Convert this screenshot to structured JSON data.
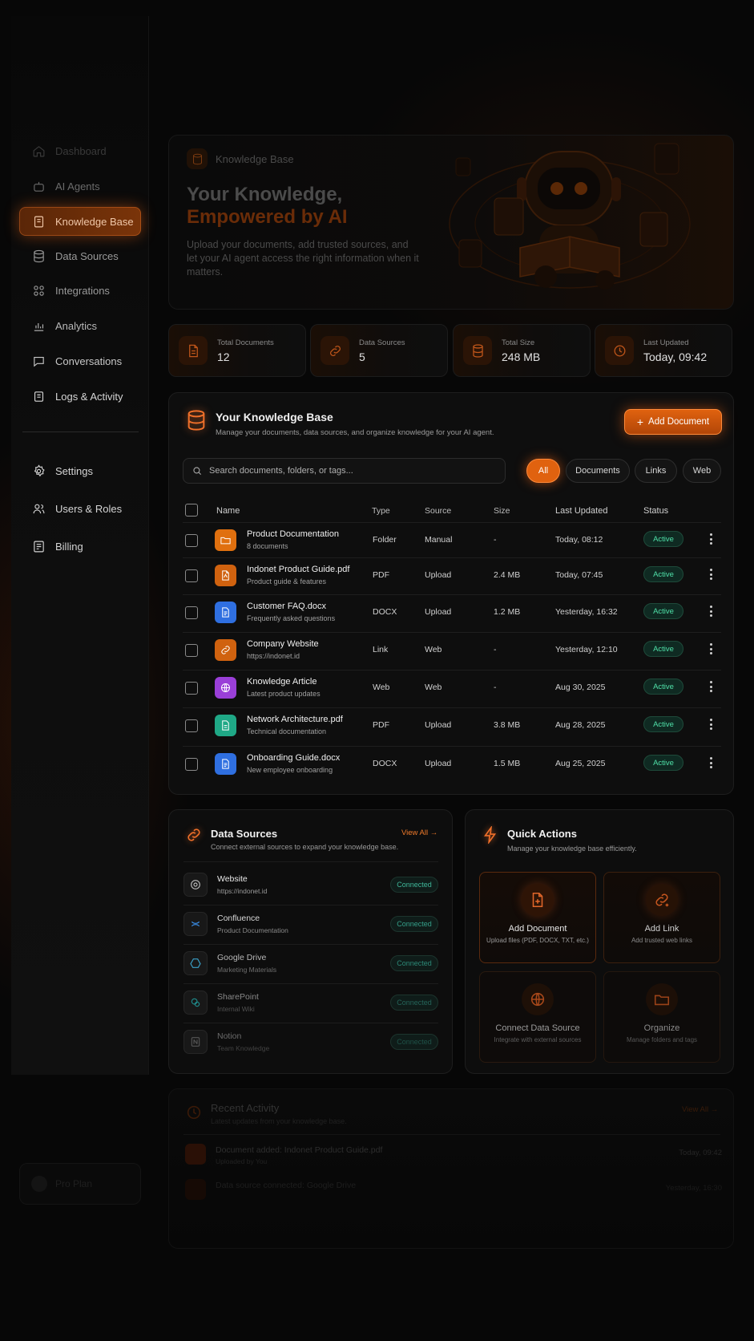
{
  "sidebar": {
    "items": [
      {
        "label": "Dashboard"
      },
      {
        "label": "AI Agents"
      },
      {
        "label": "Knowledge Base"
      },
      {
        "label": "Data Sources"
      },
      {
        "label": "Integrations"
      },
      {
        "label": "Analytics"
      },
      {
        "label": "Conversations"
      },
      {
        "label": "Logs & Activity"
      },
      {
        "label": "Settings"
      },
      {
        "label": "Users & Roles"
      },
      {
        "label": "Billing"
      }
    ],
    "plan": {
      "label": "Pro Plan"
    }
  },
  "hero": {
    "tag": "Knowledge Base",
    "title_line1": "Your Knowledge,",
    "title_line2": "Empowered by AI",
    "description": "Upload your documents, add trusted sources, and let your AI agent access the right information when it matters."
  },
  "stats": [
    {
      "label": "Total Documents",
      "value": "12",
      "icon": "document-icon"
    },
    {
      "label": "Data Sources",
      "value": "5",
      "icon": "link-icon"
    },
    {
      "label": "Total Size",
      "value": "248 MB",
      "icon": "database-icon"
    },
    {
      "label": "Last Updated",
      "value": "Today, 09:42",
      "icon": "clock-icon"
    }
  ],
  "kb": {
    "title": "Your Knowledge Base",
    "subtitle": "Manage your documents, data sources, and organize knowledge for your AI agent.",
    "add_button": "Add Document",
    "search_placeholder": "Search documents, folders, or tags...",
    "filters": [
      "All",
      "Documents",
      "Links",
      "Web"
    ],
    "columns": {
      "name": "Name",
      "type": "Type",
      "source": "Source",
      "size": "Size",
      "updated": "Last Updated",
      "status": "Status"
    },
    "rows": [
      {
        "name": "Product Documentation",
        "desc": "8 documents",
        "type": "Folder",
        "source": "Manual",
        "size": "-",
        "updated": "Today, 08:12",
        "status": "Active",
        "icon": "folder-icon",
        "color": "#e0700f"
      },
      {
        "name": "Indonet Product Guide.pdf",
        "desc": "Product guide & features",
        "type": "PDF",
        "source": "Upload",
        "size": "2.4 MB",
        "updated": "Today, 07:45",
        "status": "Active",
        "icon": "pdf-icon",
        "color": "#d0620f"
      },
      {
        "name": "Customer FAQ.docx",
        "desc": "Frequently asked questions",
        "type": "DOCX",
        "source": "Upload",
        "size": "1.2 MB",
        "updated": "Yesterday, 16:32",
        "status": "Active",
        "icon": "docx-icon",
        "color": "#2f6fe0"
      },
      {
        "name": "Company Website",
        "desc": "https://indonet.id",
        "type": "Link",
        "source": "Web",
        "size": "-",
        "updated": "Yesterday, 12:10",
        "status": "Active",
        "icon": "link-icon",
        "color": "#d0620f"
      },
      {
        "name": "Knowledge Article",
        "desc": "Latest product updates",
        "type": "Web",
        "source": "Web",
        "size": "-",
        "updated": "Aug 30, 2025",
        "status": "Active",
        "icon": "globe-icon",
        "color": "#9a3fd8"
      },
      {
        "name": "Network Architecture.pdf",
        "desc": "Technical documentation",
        "type": "PDF",
        "source": "Upload",
        "size": "3.8 MB",
        "updated": "Aug 28, 2025",
        "status": "Active",
        "icon": "sheet-icon",
        "color": "#1fa886"
      },
      {
        "name": "Onboarding Guide.docx",
        "desc": "New employee onboarding",
        "type": "DOCX",
        "source": "Upload",
        "size": "1.5 MB",
        "updated": "Aug 25, 2025",
        "status": "Active",
        "icon": "docx-icon",
        "color": "#2f6fe0"
      }
    ]
  },
  "data_sources": {
    "title": "Data Sources",
    "subtitle": "Connect external sources to expand your knowledge base.",
    "view_all": "View All",
    "items": [
      {
        "name": "Website",
        "sub": "https://indonet.id",
        "status": "Connected",
        "icon": "at-icon"
      },
      {
        "name": "Confluence",
        "sub": "Product Documentation",
        "status": "Connected",
        "icon": "confluence-icon"
      },
      {
        "name": "Google Drive",
        "sub": "Marketing Materials",
        "status": "Connected",
        "icon": "drive-icon"
      },
      {
        "name": "SharePoint",
        "sub": "Internal Wiki",
        "status": "Connected",
        "icon": "sharepoint-icon"
      },
      {
        "name": "Notion",
        "sub": "Team Knowledge",
        "status": "Connected",
        "icon": "notion-icon"
      }
    ]
  },
  "quick_actions": {
    "title": "Quick Actions",
    "subtitle": "Manage your knowledge base efficiently.",
    "items": [
      {
        "title": "Add Document",
        "desc": "Upload files (PDF, DOCX, TXT, etc.)",
        "icon": "add-document-icon"
      },
      {
        "title": "Add Link",
        "desc": "Add trusted web links",
        "icon": "add-link-icon"
      },
      {
        "title": "Connect Data Source",
        "desc": "Integrate with external sources",
        "icon": "globe-icon"
      },
      {
        "title": "Organize",
        "desc": "Manage folders and tags",
        "icon": "folder-icon"
      }
    ]
  },
  "recent": {
    "title": "Recent Activity",
    "subtitle": "Latest updates from your knowledge base.",
    "view_all": "View All",
    "items": [
      {
        "title": "Document added: Indonet Product Guide.pdf",
        "sub": "Uploaded by You",
        "time": "Today, 09:42"
      },
      {
        "title": "Data source connected: Google Drive",
        "sub": "",
        "time": "Yesterday, 16:30"
      }
    ]
  }
}
